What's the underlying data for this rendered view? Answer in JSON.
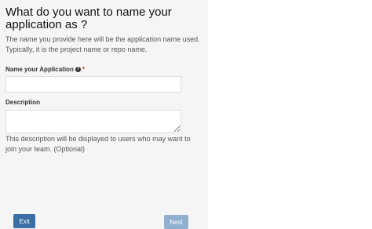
{
  "dialog": {
    "title": "What do you want to name your application as ?",
    "intro": "The name you provide here will be the application name used. Typically, it is the project name or repo name."
  },
  "fields": {
    "name": {
      "label": "Name your Application",
      "help_icon": "question-circle-icon",
      "required_mark": "*",
      "value": "",
      "placeholder": ""
    },
    "description": {
      "label": "Description",
      "value": "",
      "placeholder": "",
      "help_text": "This description will be displayed to users who may want to join your team. (Optional)"
    }
  },
  "buttons": {
    "exit_label": "Exit",
    "next_label": "Next"
  },
  "colors": {
    "panel_bg": "#f5f5f5",
    "primary": "#3a6ea5",
    "primary_disabled": "#8fb0cf",
    "required": "#c0392b"
  }
}
